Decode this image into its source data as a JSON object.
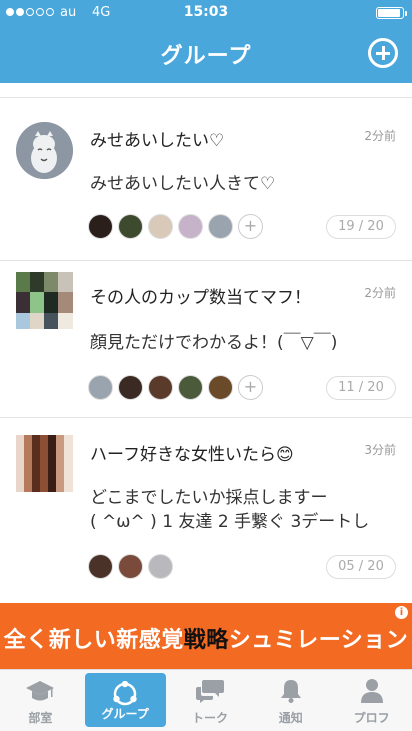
{
  "status_bar": {
    "carrier": "au",
    "network": "4G",
    "time": "15:03",
    "signal_strength": 2,
    "signal_max": 5,
    "battery_level": 0.9
  },
  "nav": {
    "title": "グループ",
    "add_icon": "plus-circle-icon"
  },
  "posts": [
    {
      "title": "みせあいしたい♡",
      "time": "2分前",
      "body_lines": [
        "みせあいしたい人きて♡"
      ],
      "member_colors": [
        "#2a1f1a",
        "#3d4a2e",
        "#d9c9b8",
        "#c6b2c9",
        "#9aa4ae"
      ],
      "show_add": true,
      "count": "19 / 20"
    },
    {
      "title": "その人のカップ数当てマフ！",
      "time": "2分前",
      "body_lines": [
        "顔見ただけでわかるよ！(￣▽￣)"
      ],
      "member_colors": [
        "#9aa4ae",
        "#3b2a24",
        "#5a3a2a",
        "#4a5a3a",
        "#6b4a2a"
      ],
      "show_add": true,
      "count": "11 / 20"
    },
    {
      "title": "ハーフ好きな女性いたら😊",
      "time": "3分前",
      "body_lines": [
        "どこまでしたいか採点しますー",
        "( ^ω^ ) 1 友達 2 手繋ぐ 3デートし"
      ],
      "member_colors": [
        "#4a3228",
        "#7a4a3a",
        "#b9b9bd"
      ],
      "show_add": false,
      "count": "05 / 20"
    }
  ],
  "ad": {
    "part1": "全く新しい新感覚",
    "highlight": "戦略",
    "part2": "シュミレーション",
    "info_label": "i",
    "bg_color": "#f36a23"
  },
  "tabs": [
    {
      "label": "部室",
      "icon": "graduation-cap-icon",
      "active": false
    },
    {
      "label": "グループ",
      "icon": "group-nodes-icon",
      "active": true
    },
    {
      "label": "トーク",
      "icon": "chat-bubbles-icon",
      "active": false
    },
    {
      "label": "通知",
      "icon": "bell-icon",
      "active": false
    },
    {
      "label": "プロフ",
      "icon": "person-icon",
      "active": false
    }
  ],
  "colors": {
    "accent": "#4aa7dc",
    "tab_inactive": "#9aa0a6"
  }
}
